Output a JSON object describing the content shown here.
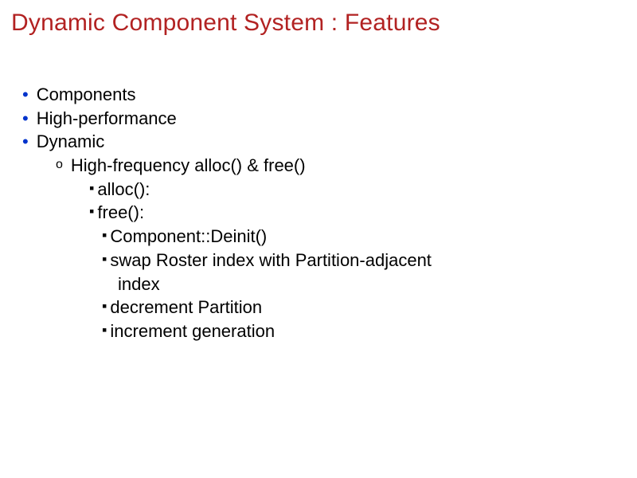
{
  "slide": {
    "title": "Dynamic Component System : Features",
    "bullets": {
      "b1": "Components",
      "b2": "High-performance",
      "b3": "Dynamic",
      "b3_1": "High-frequency alloc() & free()",
      "b3_1_1": "alloc():",
      "b3_1_2": "free():",
      "b3_1_2_1": "Component::Deinit()",
      "b3_1_2_2a": "swap Roster index with Partition-adjacent",
      "b3_1_2_2b": "index",
      "b3_1_2_3": "decrement Partition",
      "b3_1_2_4": "increment generation"
    }
  }
}
